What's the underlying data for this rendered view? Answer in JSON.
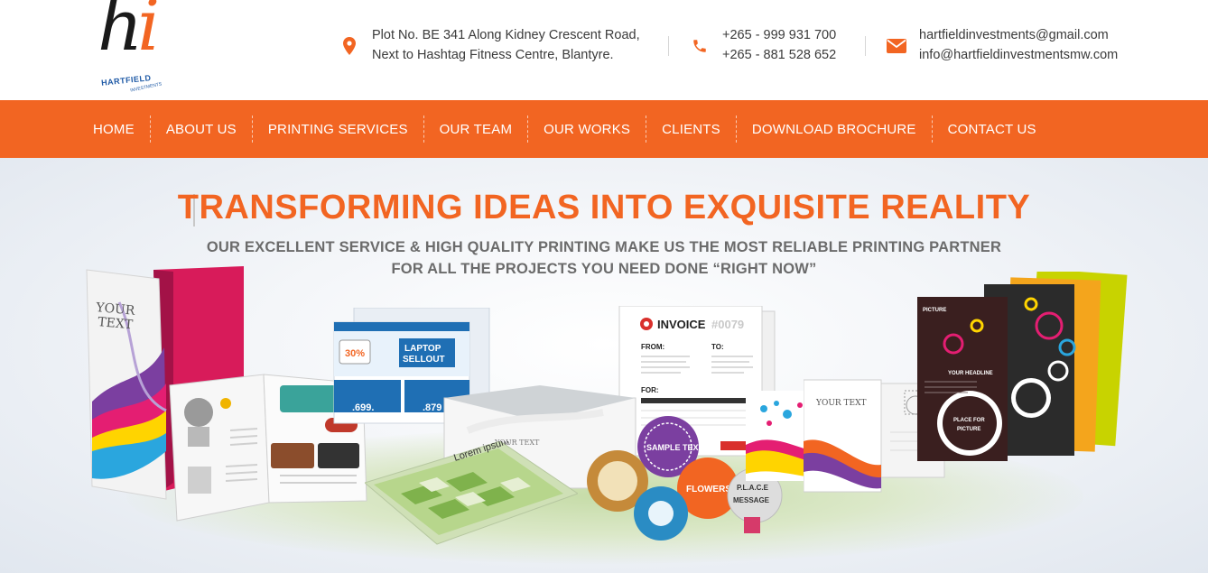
{
  "logo": {
    "mark": "hi",
    "word": "HARTFIELD",
    "sub": "INVESTMENTS"
  },
  "contacts": {
    "address": {
      "icon": "map-pin-icon",
      "line1": "Plot No. BE 341 Along Kidney Crescent Road,",
      "line2": "Next to Hashtag Fitness Centre, Blantyre."
    },
    "phone": {
      "icon": "phone-icon",
      "line1": "+265 - 999 931 700",
      "line2": "+265 - 881 528 652"
    },
    "email": {
      "icon": "envelope-icon",
      "line1": "hartfieldinvestments@gmail.com",
      "line2": "info@hartfieldinvestmentsmw.com"
    }
  },
  "nav": {
    "items": [
      {
        "label": "HOME"
      },
      {
        "label": "ABOUT US"
      },
      {
        "label": "PRINTING SERVICES"
      },
      {
        "label": "OUR TEAM"
      },
      {
        "label": "OUR WORKS"
      },
      {
        "label": "CLIENTS"
      },
      {
        "label": "DOWNLOAD BROCHURE"
      },
      {
        "label": "CONTACT US"
      }
    ]
  },
  "hero": {
    "headline": "TRANSFORMING IDEAS INTO EXQUISITE REALITY",
    "tagline1": "OUR EXCELLENT SERVICE & HIGH QUALITY PRINTING MAKE US THE MOST RELIABLE PRINTING PARTNER",
    "tagline2": "FOR ALL THE PROJECTS YOU NEED DONE “RIGHT NOW”",
    "products": {
      "folder_text_1": "YOUR",
      "folder_text_2": "TEXT",
      "laptop_percent": "30%",
      "laptop_title_1": "LAPTOP",
      "laptop_title_2": "SELLOUT",
      "laptop_price_1": ".699.",
      "laptop_price_2": ".879",
      "invoice_title": "INVOICE",
      "invoice_number": "#0079",
      "invoice_from": "FROM:",
      "invoice_to": "TO:",
      "invoice_for": "FOR:",
      "envelope_text": "YOUR TEXT",
      "booklet_text": "Lorem ipsum",
      "postcard_text": "YOUR TEXT",
      "flyer_picture_label": "PICTURE",
      "flyer_headline": "YOUR HEADLINE",
      "flyer_place_1": "PLACE FOR",
      "flyer_place_2": "PICTURE",
      "sticker_sample": "SAMPLE TEXT",
      "sticker_flowers": "FLOWERS",
      "sticker_message": "MESSAGE",
      "sticker_place": "P.L.A.C.E"
    }
  },
  "colors": {
    "accent": "#f26522",
    "nav_text": "#ffffff",
    "tagline": "#6b6b6b",
    "logo_blue": "#1f5aa6"
  }
}
